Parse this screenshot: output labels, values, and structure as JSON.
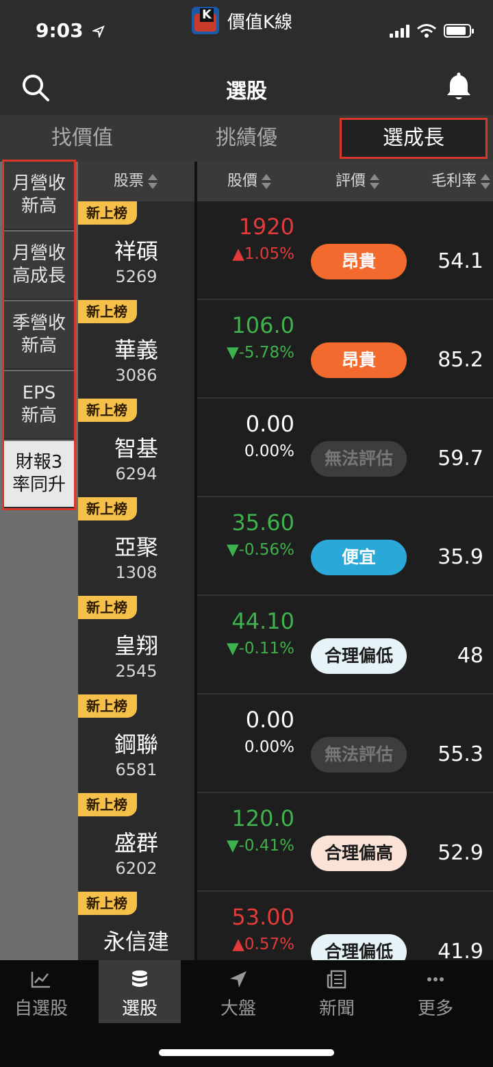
{
  "status": {
    "time": "9:03",
    "app_name": "價值K線",
    "logo_letter": "K"
  },
  "nav": {
    "title": "選股"
  },
  "tabs": [
    "找價值",
    "挑績優",
    "選成長"
  ],
  "sidebar": {
    "items": [
      {
        "line1": "月營收",
        "line2": "新高"
      },
      {
        "line1": "月營收",
        "line2": "高成長"
      },
      {
        "line1": "季營收",
        "line2": "新高"
      },
      {
        "line1": "EPS",
        "line2": "新高"
      },
      {
        "line1": "財報3",
        "line2": "率同升"
      }
    ]
  },
  "table": {
    "headers": {
      "stock": "股票",
      "price": "股價",
      "rating": "評價",
      "margin": "毛利率"
    },
    "badge_text": "新上榜",
    "rows": [
      {
        "name": "祥碩",
        "code": "5269",
        "price": "1920",
        "change": "▲1.05%",
        "trend": "up",
        "rating": "昂貴",
        "rating_style": "expensive",
        "margin": "54.1"
      },
      {
        "name": "華義",
        "code": "3086",
        "price": "106.0",
        "change": "▼-5.78%",
        "trend": "down",
        "rating": "昂貴",
        "rating_style": "expensive",
        "margin": "85.2"
      },
      {
        "name": "智基",
        "code": "6294",
        "price": "0.00",
        "change": "0.00%",
        "trend": "flat",
        "rating": "無法評估",
        "rating_style": "na",
        "margin": "59.7"
      },
      {
        "name": "亞聚",
        "code": "1308",
        "price": "35.60",
        "change": "▼-0.56%",
        "trend": "down",
        "rating": "便宜",
        "rating_style": "cheap",
        "margin": "35.9"
      },
      {
        "name": "皇翔",
        "code": "2545",
        "price": "44.10",
        "change": "▼-0.11%",
        "trend": "down",
        "rating": "合理偏低",
        "rating_style": "fairlow",
        "margin": "48"
      },
      {
        "name": "鋼聯",
        "code": "6581",
        "price": "0.00",
        "change": "0.00%",
        "trend": "flat",
        "rating": "無法評估",
        "rating_style": "na",
        "margin": "55.3"
      },
      {
        "name": "盛群",
        "code": "6202",
        "price": "120.0",
        "change": "▼-0.41%",
        "trend": "down",
        "rating": "合理偏高",
        "rating_style": "fairhigh",
        "margin": "52.9"
      },
      {
        "name": "永信建",
        "code": "",
        "price": "53.00",
        "change": "▲0.57%",
        "trend": "up",
        "rating": "合理偏低",
        "rating_style": "fairlow",
        "margin": "41.9"
      }
    ]
  },
  "rating_colors": {
    "expensive": {
      "bg": "#f26a2e",
      "fg": "#ffffff"
    },
    "na": {
      "bg": "#3d3d3d",
      "fg": "#777777"
    },
    "cheap": {
      "bg": "#2aa8d8",
      "fg": "#ffffff"
    },
    "fairlow": {
      "bg": "#e6f4f8",
      "fg": "#1a1a1a"
    },
    "fairhigh": {
      "bg": "#fbe2d6",
      "fg": "#1a1a1a"
    }
  },
  "bottom_tabs": [
    {
      "label": "自選股",
      "icon": "chart-icon"
    },
    {
      "label": "選股",
      "icon": "database-icon"
    },
    {
      "label": "大盤",
      "icon": "navigation-icon"
    },
    {
      "label": "新聞",
      "icon": "news-icon"
    },
    {
      "label": "更多",
      "icon": "more-icon"
    }
  ]
}
